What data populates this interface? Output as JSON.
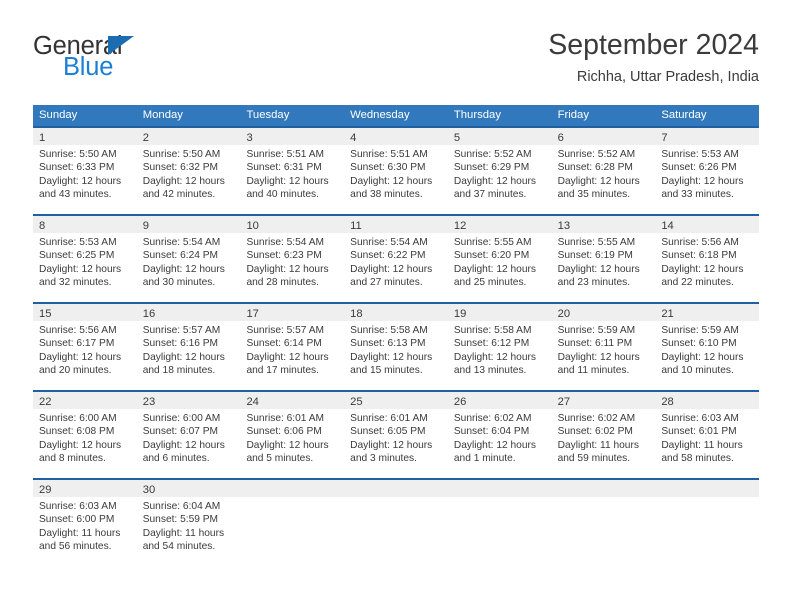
{
  "brand": {
    "name_top": "General",
    "name_bottom": "Blue",
    "accent_color": "#1b7fd4",
    "triangle_color": "#1b6cb0"
  },
  "header": {
    "title": "September 2024",
    "location": "Richha, Uttar Pradesh, India"
  },
  "calendar": {
    "header_bg": "#3179bc",
    "header_text_color": "#ffffff",
    "row_divider_color": "#1f60a0",
    "daynum_band_bg": "#efefef",
    "weekdays": [
      "Sunday",
      "Monday",
      "Tuesday",
      "Wednesday",
      "Thursday",
      "Friday",
      "Saturday"
    ],
    "weeks": [
      [
        {
          "day": "1",
          "sunrise": "Sunrise: 5:50 AM",
          "sunset": "Sunset: 6:33 PM",
          "daylight_line1": "Daylight: 12 hours",
          "daylight_line2": "and 43 minutes."
        },
        {
          "day": "2",
          "sunrise": "Sunrise: 5:50 AM",
          "sunset": "Sunset: 6:32 PM",
          "daylight_line1": "Daylight: 12 hours",
          "daylight_line2": "and 42 minutes."
        },
        {
          "day": "3",
          "sunrise": "Sunrise: 5:51 AM",
          "sunset": "Sunset: 6:31 PM",
          "daylight_line1": "Daylight: 12 hours",
          "daylight_line2": "and 40 minutes."
        },
        {
          "day": "4",
          "sunrise": "Sunrise: 5:51 AM",
          "sunset": "Sunset: 6:30 PM",
          "daylight_line1": "Daylight: 12 hours",
          "daylight_line2": "and 38 minutes."
        },
        {
          "day": "5",
          "sunrise": "Sunrise: 5:52 AM",
          "sunset": "Sunset: 6:29 PM",
          "daylight_line1": "Daylight: 12 hours",
          "daylight_line2": "and 37 minutes."
        },
        {
          "day": "6",
          "sunrise": "Sunrise: 5:52 AM",
          "sunset": "Sunset: 6:28 PM",
          "daylight_line1": "Daylight: 12 hours",
          "daylight_line2": "and 35 minutes."
        },
        {
          "day": "7",
          "sunrise": "Sunrise: 5:53 AM",
          "sunset": "Sunset: 6:26 PM",
          "daylight_line1": "Daylight: 12 hours",
          "daylight_line2": "and 33 minutes."
        }
      ],
      [
        {
          "day": "8",
          "sunrise": "Sunrise: 5:53 AM",
          "sunset": "Sunset: 6:25 PM",
          "daylight_line1": "Daylight: 12 hours",
          "daylight_line2": "and 32 minutes."
        },
        {
          "day": "9",
          "sunrise": "Sunrise: 5:54 AM",
          "sunset": "Sunset: 6:24 PM",
          "daylight_line1": "Daylight: 12 hours",
          "daylight_line2": "and 30 minutes."
        },
        {
          "day": "10",
          "sunrise": "Sunrise: 5:54 AM",
          "sunset": "Sunset: 6:23 PM",
          "daylight_line1": "Daylight: 12 hours",
          "daylight_line2": "and 28 minutes."
        },
        {
          "day": "11",
          "sunrise": "Sunrise: 5:54 AM",
          "sunset": "Sunset: 6:22 PM",
          "daylight_line1": "Daylight: 12 hours",
          "daylight_line2": "and 27 minutes."
        },
        {
          "day": "12",
          "sunrise": "Sunrise: 5:55 AM",
          "sunset": "Sunset: 6:20 PM",
          "daylight_line1": "Daylight: 12 hours",
          "daylight_line2": "and 25 minutes."
        },
        {
          "day": "13",
          "sunrise": "Sunrise: 5:55 AM",
          "sunset": "Sunset: 6:19 PM",
          "daylight_line1": "Daylight: 12 hours",
          "daylight_line2": "and 23 minutes."
        },
        {
          "day": "14",
          "sunrise": "Sunrise: 5:56 AM",
          "sunset": "Sunset: 6:18 PM",
          "daylight_line1": "Daylight: 12 hours",
          "daylight_line2": "and 22 minutes."
        }
      ],
      [
        {
          "day": "15",
          "sunrise": "Sunrise: 5:56 AM",
          "sunset": "Sunset: 6:17 PM",
          "daylight_line1": "Daylight: 12 hours",
          "daylight_line2": "and 20 minutes."
        },
        {
          "day": "16",
          "sunrise": "Sunrise: 5:57 AM",
          "sunset": "Sunset: 6:16 PM",
          "daylight_line1": "Daylight: 12 hours",
          "daylight_line2": "and 18 minutes."
        },
        {
          "day": "17",
          "sunrise": "Sunrise: 5:57 AM",
          "sunset": "Sunset: 6:14 PM",
          "daylight_line1": "Daylight: 12 hours",
          "daylight_line2": "and 17 minutes."
        },
        {
          "day": "18",
          "sunrise": "Sunrise: 5:58 AM",
          "sunset": "Sunset: 6:13 PM",
          "daylight_line1": "Daylight: 12 hours",
          "daylight_line2": "and 15 minutes."
        },
        {
          "day": "19",
          "sunrise": "Sunrise: 5:58 AM",
          "sunset": "Sunset: 6:12 PM",
          "daylight_line1": "Daylight: 12 hours",
          "daylight_line2": "and 13 minutes."
        },
        {
          "day": "20",
          "sunrise": "Sunrise: 5:59 AM",
          "sunset": "Sunset: 6:11 PM",
          "daylight_line1": "Daylight: 12 hours",
          "daylight_line2": "and 11 minutes."
        },
        {
          "day": "21",
          "sunrise": "Sunrise: 5:59 AM",
          "sunset": "Sunset: 6:10 PM",
          "daylight_line1": "Daylight: 12 hours",
          "daylight_line2": "and 10 minutes."
        }
      ],
      [
        {
          "day": "22",
          "sunrise": "Sunrise: 6:00 AM",
          "sunset": "Sunset: 6:08 PM",
          "daylight_line1": "Daylight: 12 hours",
          "daylight_line2": "and 8 minutes."
        },
        {
          "day": "23",
          "sunrise": "Sunrise: 6:00 AM",
          "sunset": "Sunset: 6:07 PM",
          "daylight_line1": "Daylight: 12 hours",
          "daylight_line2": "and 6 minutes."
        },
        {
          "day": "24",
          "sunrise": "Sunrise: 6:01 AM",
          "sunset": "Sunset: 6:06 PM",
          "daylight_line1": "Daylight: 12 hours",
          "daylight_line2": "and 5 minutes."
        },
        {
          "day": "25",
          "sunrise": "Sunrise: 6:01 AM",
          "sunset": "Sunset: 6:05 PM",
          "daylight_line1": "Daylight: 12 hours",
          "daylight_line2": "and 3 minutes."
        },
        {
          "day": "26",
          "sunrise": "Sunrise: 6:02 AM",
          "sunset": "Sunset: 6:04 PM",
          "daylight_line1": "Daylight: 12 hours",
          "daylight_line2": "and 1 minute."
        },
        {
          "day": "27",
          "sunrise": "Sunrise: 6:02 AM",
          "sunset": "Sunset: 6:02 PM",
          "daylight_line1": "Daylight: 11 hours",
          "daylight_line2": "and 59 minutes."
        },
        {
          "day": "28",
          "sunrise": "Sunrise: 6:03 AM",
          "sunset": "Sunset: 6:01 PM",
          "daylight_line1": "Daylight: 11 hours",
          "daylight_line2": "and 58 minutes."
        }
      ],
      [
        {
          "day": "29",
          "sunrise": "Sunrise: 6:03 AM",
          "sunset": "Sunset: 6:00 PM",
          "daylight_line1": "Daylight: 11 hours",
          "daylight_line2": "and 56 minutes."
        },
        {
          "day": "30",
          "sunrise": "Sunrise: 6:04 AM",
          "sunset": "Sunset: 5:59 PM",
          "daylight_line1": "Daylight: 11 hours",
          "daylight_line2": "and 54 minutes."
        },
        {
          "day": "",
          "sunrise": "",
          "sunset": "",
          "daylight_line1": "",
          "daylight_line2": ""
        },
        {
          "day": "",
          "sunrise": "",
          "sunset": "",
          "daylight_line1": "",
          "daylight_line2": ""
        },
        {
          "day": "",
          "sunrise": "",
          "sunset": "",
          "daylight_line1": "",
          "daylight_line2": ""
        },
        {
          "day": "",
          "sunrise": "",
          "sunset": "",
          "daylight_line1": "",
          "daylight_line2": ""
        },
        {
          "day": "",
          "sunrise": "",
          "sunset": "",
          "daylight_line1": "",
          "daylight_line2": ""
        }
      ]
    ]
  }
}
